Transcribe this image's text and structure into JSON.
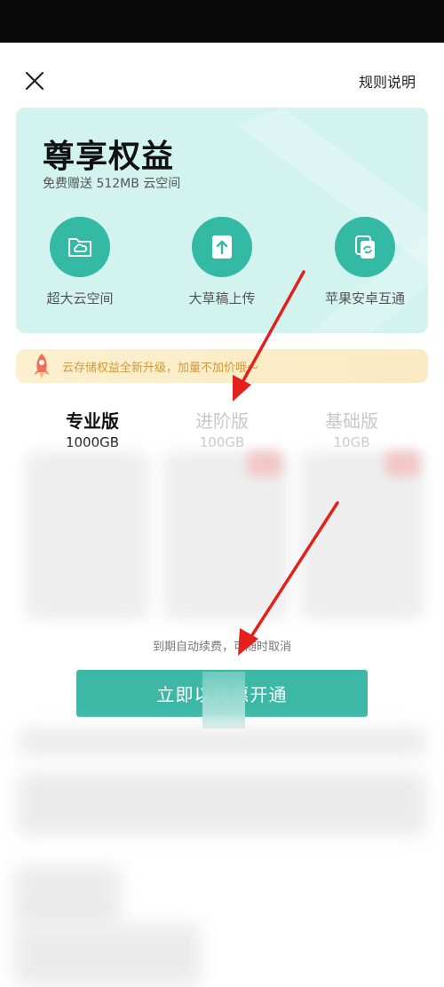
{
  "header": {
    "close_icon": "close-icon",
    "rules_label": "规则说明"
  },
  "card": {
    "title": "尊享权益",
    "subtitle": "免费赠送 512MB 云空间",
    "benefits": [
      {
        "icon": "cloud-folder-icon",
        "label": "超大云空间"
      },
      {
        "icon": "upload-arrow-icon",
        "label": "大草稿上传"
      },
      {
        "icon": "sync-icon",
        "label": "苹果安卓互通"
      }
    ]
  },
  "banner": {
    "icon": "rocket-icon",
    "text": "云存储权益全新升级，加量不加价哦～"
  },
  "tiers": [
    {
      "name": "专业版",
      "size": "1000GB",
      "active": true
    },
    {
      "name": "进阶版",
      "size": "100GB",
      "active": false
    },
    {
      "name": "基础版",
      "size": "10GB",
      "active": false
    }
  ],
  "renew_note": "到期自动续费，可随时取消",
  "cta_label": "立即以优惠开通",
  "colors": {
    "accent": "#3db8a7",
    "card_bg": "#d3f3ef",
    "banner_text": "#d19a36",
    "annotation_arrow": "#e3201b"
  }
}
